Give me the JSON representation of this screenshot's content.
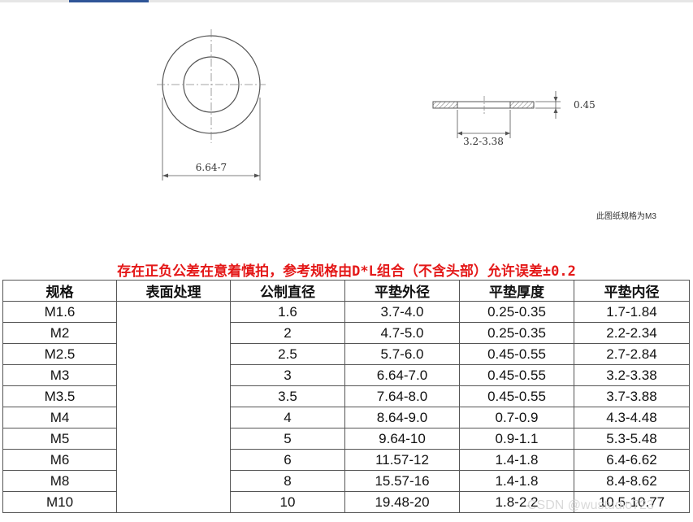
{
  "drawing": {
    "outer_diameter_label": "6.64-7",
    "inner_diameter_label": "3.2-3.38",
    "thickness_label": "0.45",
    "scale_note": "此图纸规格为M3"
  },
  "warning": "存在正负公差在意着慎拍，参考规格由D*L组合（不含头部）允许误差±0.2",
  "table": {
    "headers": [
      "规格",
      "表面处理",
      "公制直径",
      "平垫外径",
      "平垫厚度",
      "平垫内径"
    ],
    "rows": [
      [
        "M1.6",
        "1.6",
        "3.7-4.0",
        "0.25-0.35",
        "1.7-1.84"
      ],
      [
        "M2",
        "2",
        "4.7-5.0",
        "0.25-0.35",
        "2.2-2.34"
      ],
      [
        "M2.5",
        "2.5",
        "5.7-6.0",
        "0.45-0.55",
        "2.7-2.84"
      ],
      [
        "M3",
        "3",
        "6.64-7.0",
        "0.45-0.55",
        "3.2-3.38"
      ],
      [
        "M3.5",
        "3.5",
        "7.64-8.0",
        "0.45-0.55",
        "3.7-3.88"
      ],
      [
        "M4",
        "4",
        "8.64-9.0",
        "0.7-0.9",
        "4.3-4.48"
      ],
      [
        "M5",
        "5",
        "9.64-10",
        "0.9-1.1",
        "5.3-5.48"
      ],
      [
        "M6",
        "6",
        "11.57-12",
        "1.4-1.8",
        "6.4-6.62"
      ],
      [
        "M8",
        "8",
        "15.57-16",
        "1.4-1.8",
        "8.4-8.62"
      ],
      [
        "M10",
        "10",
        "19.48-20",
        "1.8-2.2",
        "10.5-10.77"
      ]
    ]
  },
  "watermark": "CSDN @wustudio723"
}
